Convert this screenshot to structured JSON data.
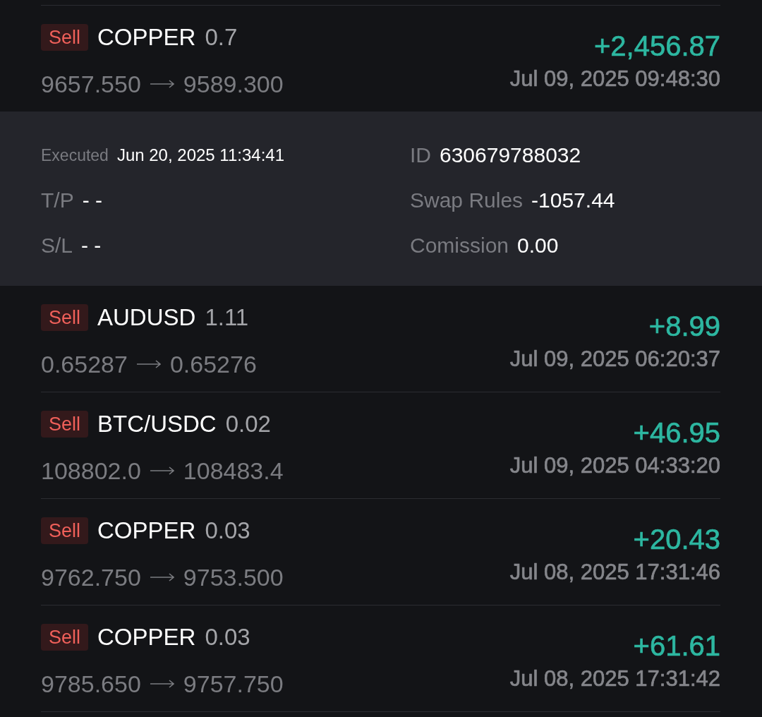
{
  "trades": [
    {
      "side": "Sell",
      "symbol": "COPPER",
      "volume": "0.7",
      "open_price": "9657.550",
      "close_price": "9589.300",
      "profit": "+2,456.87",
      "time": "Jul 09, 2025 09:48:30",
      "detail_rows": [
        {
          "fields": [
            {
              "label": "Executed",
              "value": "Jun 20, 2025 11:34:41"
            },
            {
              "label": "ID",
              "value": "630679788032"
            }
          ]
        },
        {
          "fields": [
            {
              "label": "T/P",
              "value": "- -"
            },
            {
              "label": "Swap Rules",
              "value": "-1057.44"
            }
          ]
        },
        {
          "fields": [
            {
              "label": "S/L",
              "value": "- -"
            },
            {
              "label": "Comission",
              "value": "0.00"
            }
          ]
        }
      ]
    },
    {
      "side": "Sell",
      "symbol": "AUDUSD",
      "volume": "1.11",
      "open_price": "0.65287",
      "close_price": "0.65276",
      "profit": "+8.99",
      "time": "Jul 09, 2025 06:20:37"
    },
    {
      "side": "Sell",
      "symbol": "BTC/USDC",
      "volume": "0.02",
      "open_price": "108802.0",
      "close_price": "108483.4",
      "profit": "+46.95",
      "time": "Jul 09, 2025 04:33:20"
    },
    {
      "side": "Sell",
      "symbol": "COPPER",
      "volume": "0.03",
      "open_price": "9762.750",
      "close_price": "9753.500",
      "profit": "+20.43",
      "time": "Jul 08, 2025 17:31:46"
    },
    {
      "side": "Sell",
      "symbol": "COPPER",
      "volume": "0.03",
      "open_price": "9785.650",
      "close_price": "9757.750",
      "profit": "+61.61",
      "time": "Jul 08, 2025 17:31:42"
    }
  ]
}
